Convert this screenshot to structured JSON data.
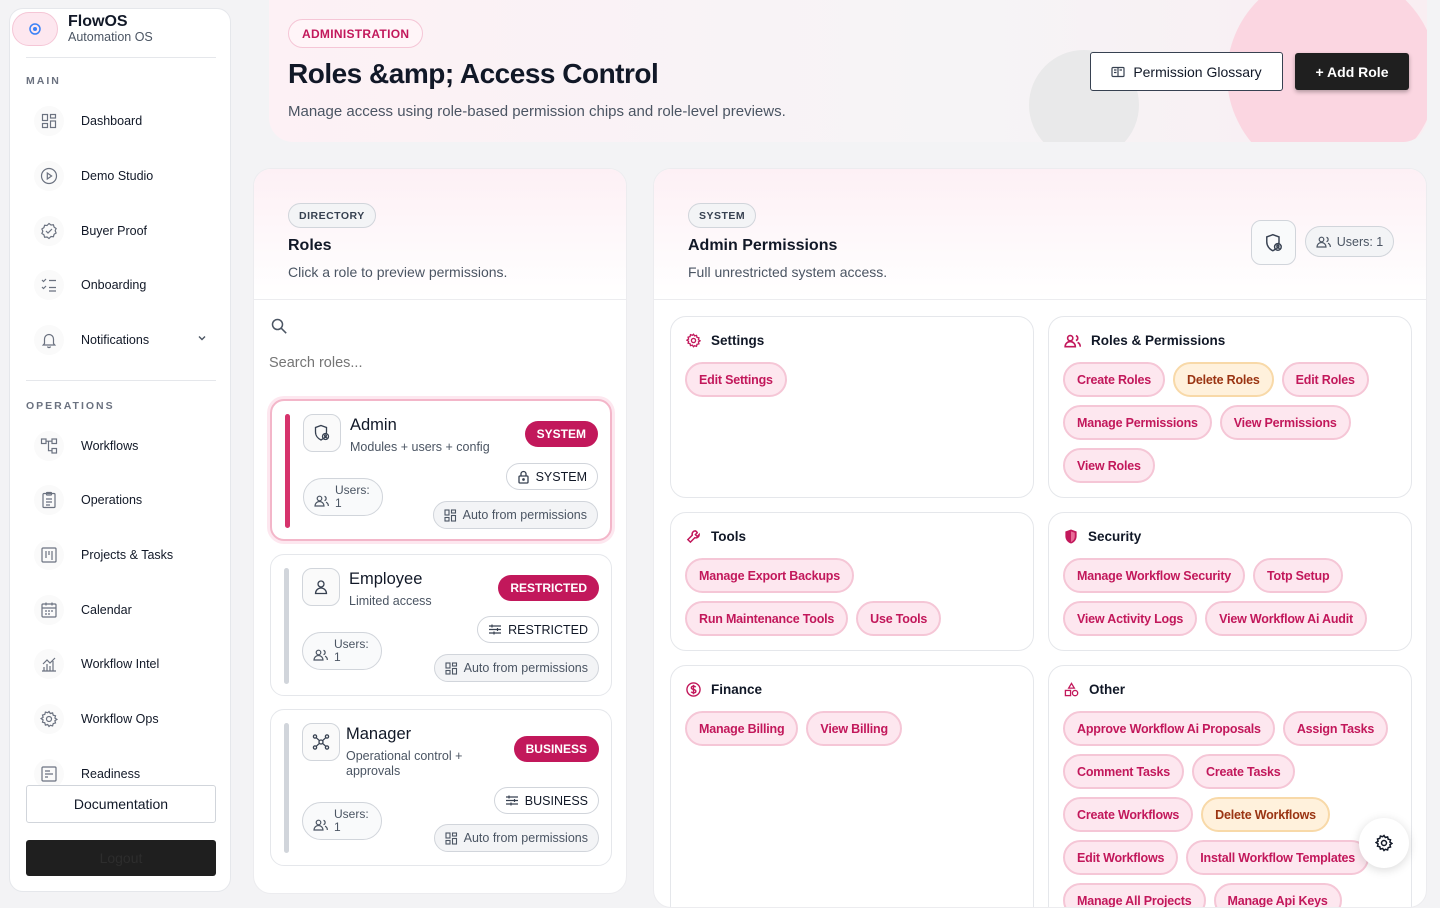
{
  "brand": {
    "name": "FlowOS",
    "subtitle": "Automation OS"
  },
  "sidebar": {
    "main_label": "MAIN",
    "main_items": [
      {
        "label": "Dashboard",
        "icon": "grid-icon"
      },
      {
        "label": "Demo Studio",
        "icon": "play-circle-icon"
      },
      {
        "label": "Buyer Proof",
        "icon": "badge-check-icon"
      },
      {
        "label": "Onboarding",
        "icon": "list-checks-icon"
      },
      {
        "label": "Notifications",
        "icon": "bell-icon"
      }
    ],
    "ops_label": "OPERATIONS",
    "ops_items": [
      {
        "label": "Workflows",
        "icon": "workflow-icon"
      },
      {
        "label": "Operations",
        "icon": "clipboard-icon"
      },
      {
        "label": "Projects & Tasks",
        "icon": "kanban-icon"
      },
      {
        "label": "Calendar",
        "icon": "calendar-icon"
      },
      {
        "label": "Workflow Intel",
        "icon": "chart-icon"
      },
      {
        "label": "Workflow Ops",
        "icon": "gear-icon"
      },
      {
        "label": "Readiness",
        "icon": "checklist-icon"
      }
    ],
    "documentation": "Documentation",
    "logout": "Logout"
  },
  "header": {
    "badge": "ADMINISTRATION",
    "title": "Roles &amp; Access Control",
    "subtitle": "Manage access using role-based permission chips and role-level previews.",
    "glossary_button": "Permission Glossary",
    "add_button": "+ Add Role"
  },
  "directory": {
    "badge": "DIRECTORY",
    "title": "Roles",
    "subtitle": "Click a role to preview permissions.",
    "search_placeholder": "Search roles...",
    "roles": [
      {
        "name": "Admin",
        "desc": "Modules + users + config",
        "badge": "SYSTEM",
        "type": "SYSTEM",
        "users_label": "Users:",
        "users": "1",
        "auto": "Auto from permissions",
        "selected": true
      },
      {
        "name": "Employee",
        "desc": "Limited access",
        "badge": "RESTRICTED",
        "type": "RESTRICTED",
        "users_label": "Users:",
        "users": "1",
        "auto": "Auto from permissions",
        "selected": false
      },
      {
        "name": "Manager",
        "desc": "Operational control + approvals",
        "badge": "BUSINESS",
        "type": "BUSINESS",
        "users_label": "Users:",
        "users": "1",
        "auto": "Auto from permissions",
        "selected": false
      }
    ]
  },
  "detail": {
    "badge": "SYSTEM",
    "title": "Admin Permissions",
    "subtitle": "Full unrestricted system access.",
    "users_chip": "Users: 1",
    "groups": {
      "settings": {
        "title": "Settings",
        "icon": "gear-icon",
        "perms": [
          "Edit Settings"
        ]
      },
      "roles": {
        "title": "Roles & Permissions",
        "icon": "users-icon",
        "perms": [
          "Create Roles",
          "Delete Roles",
          "Edit Roles",
          "Manage Permissions",
          "View Permissions",
          "View Roles"
        ]
      },
      "tools": {
        "title": "Tools",
        "icon": "wrench-icon",
        "perms": [
          "Manage Export Backups",
          "Run Maintenance Tools",
          "Use Tools"
        ]
      },
      "security": {
        "title": "Security",
        "icon": "shield-icon",
        "perms": [
          "Manage Workflow Security",
          "Totp Setup",
          "View Activity Logs",
          "View Workflow Ai Audit"
        ]
      },
      "finance": {
        "title": "Finance",
        "icon": "dollar-circle-icon",
        "perms": [
          "Manage Billing",
          "View Billing"
        ]
      },
      "other": {
        "title": "Other",
        "icon": "shapes-icon",
        "perms": [
          "Approve Workflow Ai Proposals",
          "Assign Tasks",
          "Comment Tasks",
          "Create Tasks",
          "Create Workflows",
          "Delete Workflows",
          "Edit Workflows",
          "Install Workflow Templates",
          "Manage All Projects",
          "Manage Api Keys"
        ]
      }
    }
  },
  "colors": {
    "accent": "#c2185b",
    "chip_bg": "#fde7ef",
    "amber_bg": "#fff1dc",
    "dark_button": "#1f1f1f"
  }
}
